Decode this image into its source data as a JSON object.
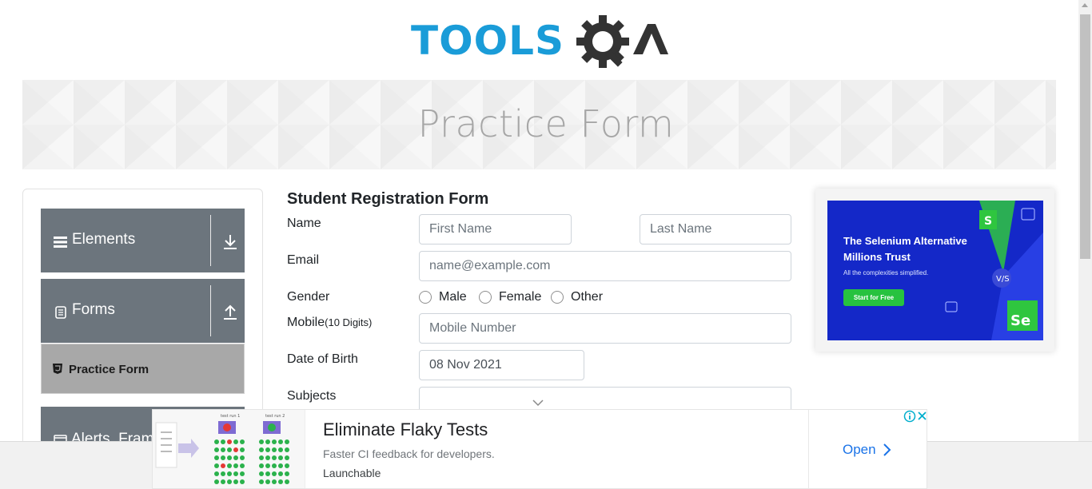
{
  "logo": {
    "text_left": "TOOLS",
    "text_right": "QA",
    "colors": {
      "tools": "#1a9cd8",
      "qa": "#333333"
    }
  },
  "banner": {
    "title": "Practice Form"
  },
  "sidebar": {
    "groups": [
      {
        "label": "Elements",
        "icon": "hamburger-icon",
        "toggle_icon": "download-arrow-icon"
      },
      {
        "label": "Forms",
        "icon": "document-icon",
        "toggle_icon": "upload-arrow-icon"
      },
      {
        "label": "Alerts, Frame & Windows",
        "icon": "window-icon"
      }
    ],
    "active_item": {
      "label": "Practice Form",
      "icon": "html5-icon"
    }
  },
  "form": {
    "title": "Student Registration Form",
    "labels": {
      "name": "Name",
      "email": "Email",
      "gender": "Gender",
      "mobile": "Mobile",
      "mobile_hint": "(10 Digits)",
      "dob": "Date of Birth",
      "subjects": "Subjects"
    },
    "placeholders": {
      "first_name": "First Name",
      "last_name": "Last Name",
      "email": "name@example.com",
      "mobile": "Mobile Number"
    },
    "values": {
      "dob": "08 Nov 2021",
      "subjects": ""
    },
    "gender_options": [
      "Male",
      "Female",
      "Other"
    ]
  },
  "side_ad": {
    "headline_1": "The Selenium Alternative",
    "headline_2": "Millions Trust",
    "subtext": "All the complexities simplified.",
    "button": "Start for Free",
    "colors": {
      "bg": "#1428c8",
      "button": "#27c23f"
    }
  },
  "bottom_ad": {
    "title": "Eliminate Flaky Tests",
    "description": "Faster CI feedback for developers.",
    "brand": "Launchable",
    "cta": "Open",
    "thumb_labels": [
      "test run 1",
      "test run 2"
    ]
  }
}
